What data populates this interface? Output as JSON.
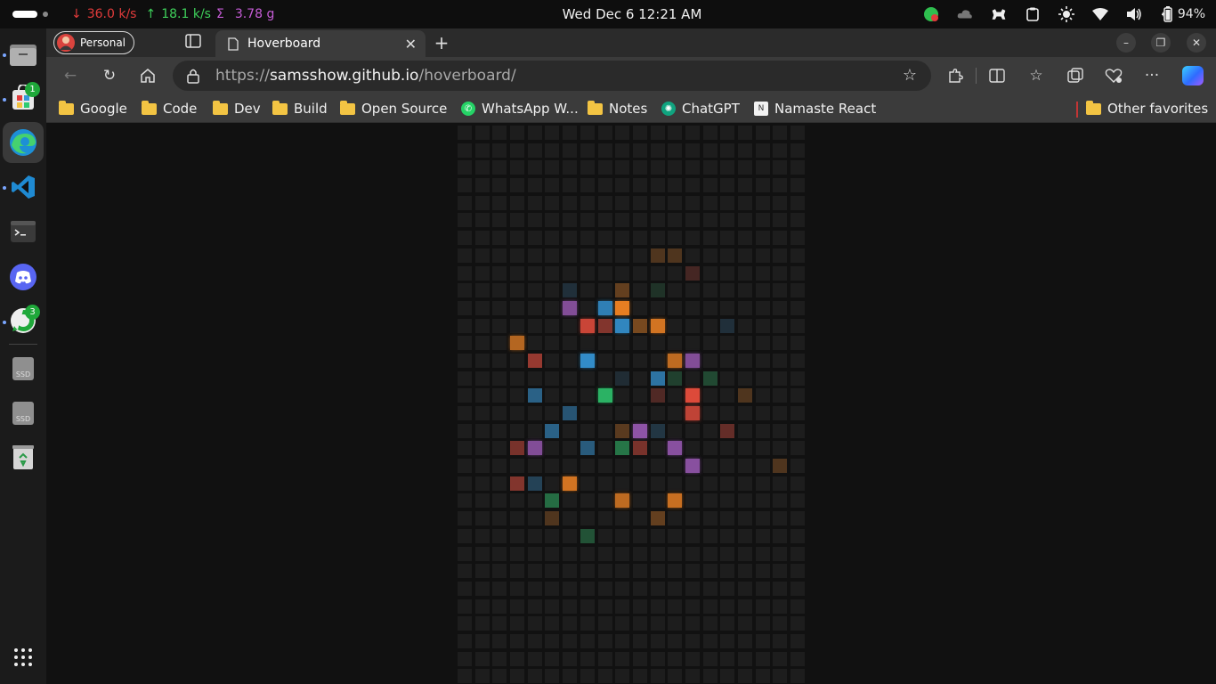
{
  "system_bar": {
    "net_down": "36.0 k/s",
    "net_up": "18.1 k/s",
    "net_sum_symbol": "Σ",
    "net_sum": "3.78 g",
    "clock": "Wed Dec 6  12:21 AM",
    "battery": "94%"
  },
  "dock": {
    "items": [
      {
        "name": "files-icon"
      },
      {
        "name": "software-icon",
        "badge": "1"
      },
      {
        "name": "edge-icon"
      },
      {
        "name": "vscode-icon"
      },
      {
        "name": "terminal-icon"
      },
      {
        "name": "discord-icon"
      },
      {
        "name": "whatsapp-icon",
        "badge": "3"
      },
      {
        "name": "ssd-icon",
        "label": "SSD"
      },
      {
        "name": "ssd-icon",
        "label": "SSD"
      },
      {
        "name": "trash-icon"
      },
      {
        "name": "app-grid-icon"
      }
    ]
  },
  "browser": {
    "profile_label": "Personal",
    "tab_title": "Hoverboard",
    "url": {
      "scheme": "https://",
      "host": "samsshow.github.io",
      "path": "/hoverboard/"
    },
    "favorites": [
      {
        "label": "Google",
        "type": "folder"
      },
      {
        "label": "Code",
        "type": "folder"
      },
      {
        "label": "Dev",
        "type": "folder"
      },
      {
        "label": "Build",
        "type": "folder"
      },
      {
        "label": "Open Source",
        "type": "folder"
      },
      {
        "label": "WhatsApp W...",
        "type": "site"
      },
      {
        "label": "Notes",
        "type": "folder"
      },
      {
        "label": "ChatGPT",
        "type": "site"
      },
      {
        "label": "Namaste React",
        "type": "site"
      }
    ],
    "other_favorites": "Other favorites"
  },
  "colors": {
    "board_bg": "#1d1d1d",
    "red": "#e74c3c",
    "orange": "#e67e22",
    "blue": "#3498db",
    "purple": "#9b59b6",
    "green": "#2ecc71"
  },
  "board": {
    "columns": 20,
    "rows": 32,
    "lit_cells": [
      {
        "r": 7,
        "c": 11,
        "color": "orange",
        "level": 0.25
      },
      {
        "r": 7,
        "c": 12,
        "color": "orange",
        "level": 0.25
      },
      {
        "r": 8,
        "c": 13,
        "color": "red",
        "level": 0.2
      },
      {
        "r": 9,
        "c": 6,
        "color": "blue",
        "level": 0.15
      },
      {
        "r": 9,
        "c": 9,
        "color": "orange",
        "level": 0.35
      },
      {
        "r": 9,
        "c": 11,
        "color": "green",
        "level": 0.12
      },
      {
        "r": 10,
        "c": 6,
        "color": "purple",
        "level": 0.8
      },
      {
        "r": 10,
        "c": 8,
        "color": "blue",
        "level": 0.8
      },
      {
        "r": 10,
        "c": 9,
        "color": "orange",
        "level": 1.0
      },
      {
        "r": 11,
        "c": 7,
        "color": "red",
        "level": 0.85
      },
      {
        "r": 11,
        "c": 8,
        "color": "red",
        "level": 0.5
      },
      {
        "r": 11,
        "c": 9,
        "color": "blue",
        "level": 0.85
      },
      {
        "r": 11,
        "c": 10,
        "color": "orange",
        "level": 0.45
      },
      {
        "r": 11,
        "c": 11,
        "color": "orange",
        "level": 0.9
      },
      {
        "r": 11,
        "c": 15,
        "color": "blue",
        "level": 0.15
      },
      {
        "r": 12,
        "c": 3,
        "color": "orange",
        "level": 0.75
      },
      {
        "r": 13,
        "c": 4,
        "color": "red",
        "level": 0.6
      },
      {
        "r": 13,
        "c": 7,
        "color": "blue",
        "level": 0.9
      },
      {
        "r": 13,
        "c": 12,
        "color": "orange",
        "level": 0.8
      },
      {
        "r": 13,
        "c": 13,
        "color": "purple",
        "level": 0.8
      },
      {
        "r": 14,
        "c": 9,
        "color": "blue",
        "level": 0.12
      },
      {
        "r": 14,
        "c": 11,
        "color": "blue",
        "level": 0.7
      },
      {
        "r": 14,
        "c": 12,
        "color": "green",
        "level": 0.2
      },
      {
        "r": 14,
        "c": 14,
        "color": "green",
        "level": 0.25
      },
      {
        "r": 15,
        "c": 4,
        "color": "blue",
        "level": 0.55
      },
      {
        "r": 15,
        "c": 8,
        "color": "green",
        "level": 0.85
      },
      {
        "r": 15,
        "c": 11,
        "color": "red",
        "level": 0.25
      },
      {
        "r": 15,
        "c": 13,
        "color": "red",
        "level": 0.95
      },
      {
        "r": 15,
        "c": 16,
        "color": "orange",
        "level": 0.25
      },
      {
        "r": 16,
        "c": 6,
        "color": "blue",
        "level": 0.45
      },
      {
        "r": 16,
        "c": 13,
        "color": "red",
        "level": 0.8
      },
      {
        "r": 17,
        "c": 5,
        "color": "blue",
        "level": 0.55
      },
      {
        "r": 17,
        "c": 9,
        "color": "orange",
        "level": 0.3
      },
      {
        "r": 17,
        "c": 10,
        "color": "purple",
        "level": 0.9
      },
      {
        "r": 17,
        "c": 11,
        "color": "blue",
        "level": 0.2
      },
      {
        "r": 17,
        "c": 15,
        "color": "red",
        "level": 0.35
      },
      {
        "r": 18,
        "c": 3,
        "color": "red",
        "level": 0.45
      },
      {
        "r": 18,
        "c": 4,
        "color": "purple",
        "level": 0.8
      },
      {
        "r": 18,
        "c": 7,
        "color": "blue",
        "level": 0.5
      },
      {
        "r": 18,
        "c": 9,
        "color": "green",
        "level": 0.5
      },
      {
        "r": 18,
        "c": 10,
        "color": "red",
        "level": 0.45
      },
      {
        "r": 18,
        "c": 12,
        "color": "purple",
        "level": 0.85
      },
      {
        "r": 19,
        "c": 13,
        "color": "purple",
        "level": 0.85
      },
      {
        "r": 19,
        "c": 18,
        "color": "orange",
        "level": 0.25
      },
      {
        "r": 20,
        "c": 3,
        "color": "red",
        "level": 0.5
      },
      {
        "r": 20,
        "c": 4,
        "color": "blue",
        "level": 0.3
      },
      {
        "r": 20,
        "c": 6,
        "color": "orange",
        "level": 0.9
      },
      {
        "r": 21,
        "c": 5,
        "color": "green",
        "level": 0.45
      },
      {
        "r": 21,
        "c": 9,
        "color": "orange",
        "level": 0.8
      },
      {
        "r": 21,
        "c": 12,
        "color": "orange",
        "level": 0.85
      },
      {
        "r": 22,
        "c": 5,
        "color": "orange",
        "level": 0.25
      },
      {
        "r": 22,
        "c": 11,
        "color": "orange",
        "level": 0.35
      },
      {
        "r": 23,
        "c": 7,
        "color": "green",
        "level": 0.3
      }
    ]
  }
}
